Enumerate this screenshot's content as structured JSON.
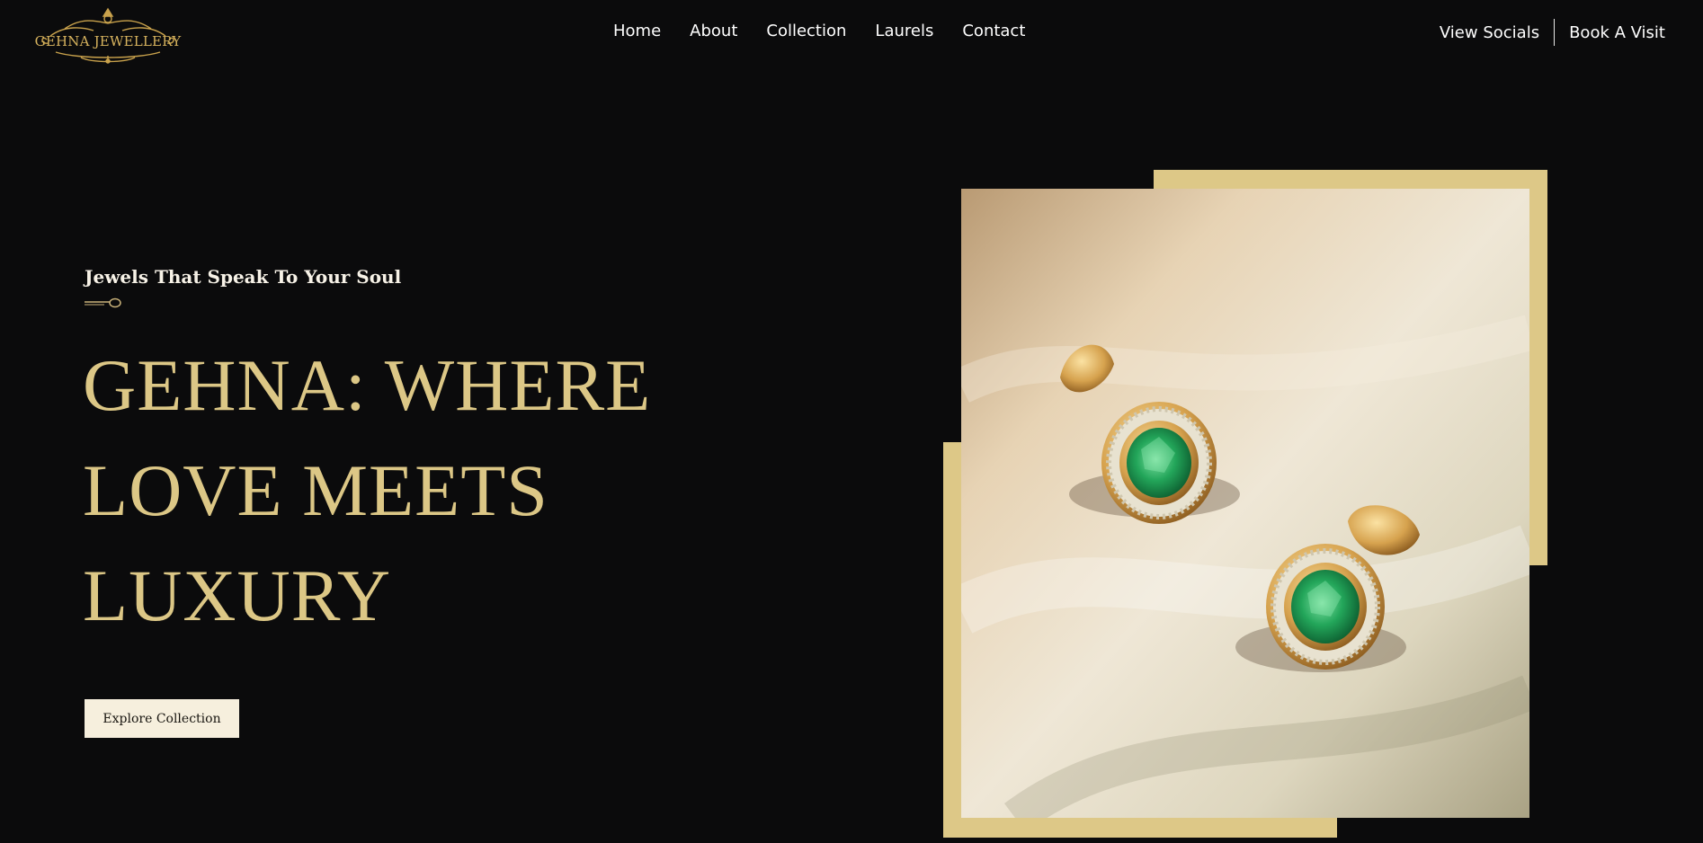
{
  "header": {
    "logo_text": "GEHNA JEWELLERY",
    "nav": [
      {
        "label": "Home"
      },
      {
        "label": "About"
      },
      {
        "label": "Collection"
      },
      {
        "label": "Laurels"
      },
      {
        "label": "Contact"
      }
    ],
    "view_socials": "View Socials",
    "book_visit": "Book A Visit"
  },
  "hero": {
    "tagline": "Jewels That Speak To Your Soul",
    "headline": "GEHNA: WHERE LOVE MEETS LUXURY",
    "cta_label": "Explore Collection"
  },
  "colors": {
    "background": "#0b0b0c",
    "gold_accent": "#ddc887",
    "headline_gold": "#dcc786",
    "button_bg": "#f6efdd",
    "emerald": "#1f9a55"
  },
  "icons": {
    "ornament": "ornament-divider-icon",
    "logo": "crown-crest-logo"
  }
}
